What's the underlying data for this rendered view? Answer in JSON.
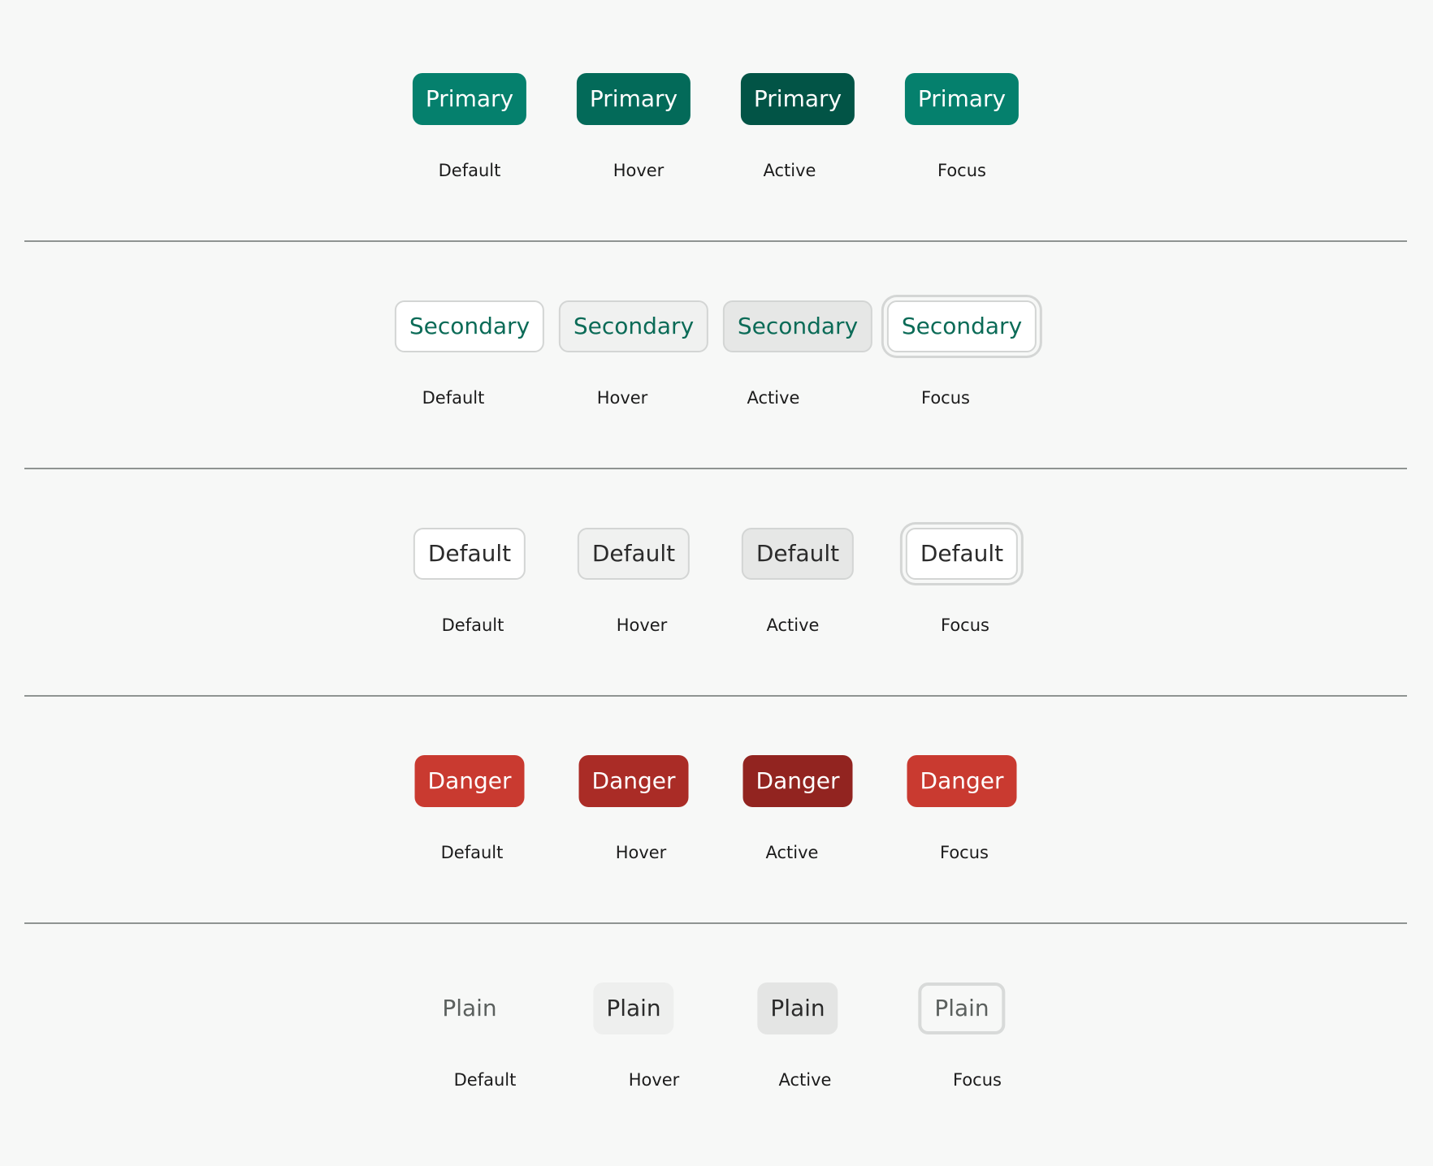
{
  "colors": {
    "background": "#f7f8f7",
    "primary": "#05806d",
    "primary_hover": "#036a59",
    "primary_active": "#025446",
    "secondary_text": "#0b6b57",
    "danger": "#c93a30",
    "danger_hover": "#aa2c26",
    "danger_active": "#922420",
    "divider": "#8f9492"
  },
  "rows": [
    {
      "variant": "primary",
      "button_label": "Primary",
      "states": [
        "Default",
        "Hover",
        "Active",
        "Focus"
      ]
    },
    {
      "variant": "secondary",
      "button_label": "Secondary",
      "states": [
        "Default",
        "Hover",
        "Active",
        "Focus"
      ]
    },
    {
      "variant": "default",
      "button_label": "Default",
      "states": [
        "Default",
        "Hover",
        "Active",
        "Focus"
      ]
    },
    {
      "variant": "danger",
      "button_label": "Danger",
      "states": [
        "Default",
        "Hover",
        "Active",
        "Focus"
      ]
    },
    {
      "variant": "plain",
      "button_label": "Plain",
      "states": [
        "Default",
        "Hover",
        "Active",
        "Focus"
      ]
    }
  ]
}
